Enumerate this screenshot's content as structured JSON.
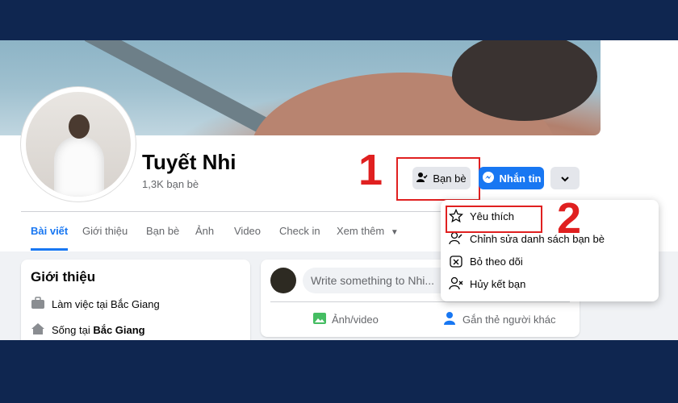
{
  "profile": {
    "name": "Tuyết Nhi",
    "friends_count": "1,3K bạn bè"
  },
  "actions": {
    "friends_label": "Bạn bè",
    "message_label": "Nhắn tin",
    "more_icon": "chevron-down-icon"
  },
  "annotations": {
    "step1": "1",
    "step2": "2",
    "color": "#e02020"
  },
  "tabs": [
    {
      "label": "Bài viết",
      "active": true
    },
    {
      "label": "Giới thiệu"
    },
    {
      "label": "Bạn bè"
    },
    {
      "label": "Ảnh"
    },
    {
      "label": "Video"
    },
    {
      "label": "Check in"
    },
    {
      "label": "Xem thêm"
    }
  ],
  "intro": {
    "title": "Giới thiệu",
    "work_text": "Làm việc tại Bắc Giang",
    "lives_prefix": "Sống tại ",
    "lives_place": "Bắc Giang"
  },
  "composer": {
    "placeholder": "Write something to Nhi...",
    "photo_label": "Ảnh/video",
    "tag_label": "Gắn thẻ người khác"
  },
  "friend_menu": {
    "items": [
      {
        "label": "Yêu thích",
        "icon": "star-icon"
      },
      {
        "label": "Chỉnh sửa danh sách bạn bè",
        "icon": "person-edit-icon"
      },
      {
        "label": "Bỏ theo dõi",
        "icon": "unfollow-icon"
      },
      {
        "label": "Hủy kết bạn",
        "icon": "person-remove-icon"
      }
    ]
  },
  "colors": {
    "accent": "#1877f2",
    "page_bg": "#f0f2f5",
    "frame": "#0f2650"
  }
}
